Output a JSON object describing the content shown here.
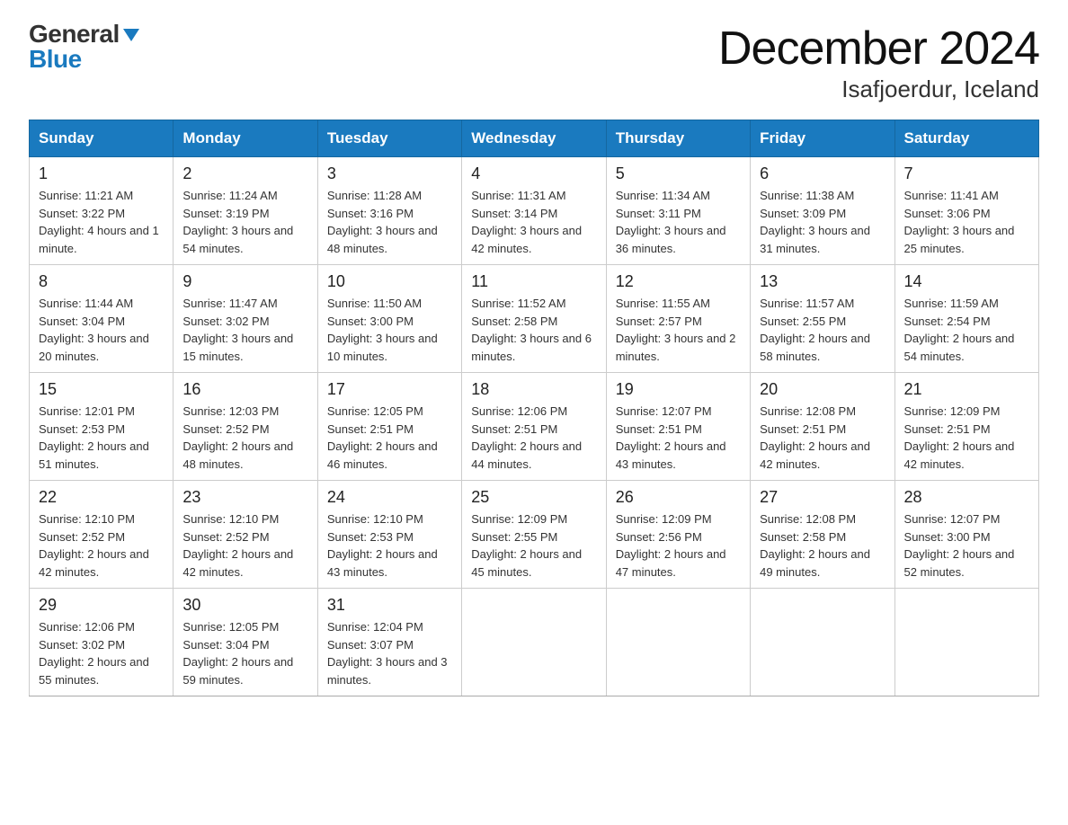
{
  "logo": {
    "general": "General",
    "blue": "Blue"
  },
  "title": "December 2024",
  "subtitle": "Isafjoerdur, Iceland",
  "weekdays": [
    "Sunday",
    "Monday",
    "Tuesday",
    "Wednesday",
    "Thursday",
    "Friday",
    "Saturday"
  ],
  "weeks": [
    [
      {
        "num": "1",
        "sunrise": "11:21 AM",
        "sunset": "3:22 PM",
        "daylight": "4 hours and 1 minute."
      },
      {
        "num": "2",
        "sunrise": "11:24 AM",
        "sunset": "3:19 PM",
        "daylight": "3 hours and 54 minutes."
      },
      {
        "num": "3",
        "sunrise": "11:28 AM",
        "sunset": "3:16 PM",
        "daylight": "3 hours and 48 minutes."
      },
      {
        "num": "4",
        "sunrise": "11:31 AM",
        "sunset": "3:14 PM",
        "daylight": "3 hours and 42 minutes."
      },
      {
        "num": "5",
        "sunrise": "11:34 AM",
        "sunset": "3:11 PM",
        "daylight": "3 hours and 36 minutes."
      },
      {
        "num": "6",
        "sunrise": "11:38 AM",
        "sunset": "3:09 PM",
        "daylight": "3 hours and 31 minutes."
      },
      {
        "num": "7",
        "sunrise": "11:41 AM",
        "sunset": "3:06 PM",
        "daylight": "3 hours and 25 minutes."
      }
    ],
    [
      {
        "num": "8",
        "sunrise": "11:44 AM",
        "sunset": "3:04 PM",
        "daylight": "3 hours and 20 minutes."
      },
      {
        "num": "9",
        "sunrise": "11:47 AM",
        "sunset": "3:02 PM",
        "daylight": "3 hours and 15 minutes."
      },
      {
        "num": "10",
        "sunrise": "11:50 AM",
        "sunset": "3:00 PM",
        "daylight": "3 hours and 10 minutes."
      },
      {
        "num": "11",
        "sunrise": "11:52 AM",
        "sunset": "2:58 PM",
        "daylight": "3 hours and 6 minutes."
      },
      {
        "num": "12",
        "sunrise": "11:55 AM",
        "sunset": "2:57 PM",
        "daylight": "3 hours and 2 minutes."
      },
      {
        "num": "13",
        "sunrise": "11:57 AM",
        "sunset": "2:55 PM",
        "daylight": "2 hours and 58 minutes."
      },
      {
        "num": "14",
        "sunrise": "11:59 AM",
        "sunset": "2:54 PM",
        "daylight": "2 hours and 54 minutes."
      }
    ],
    [
      {
        "num": "15",
        "sunrise": "12:01 PM",
        "sunset": "2:53 PM",
        "daylight": "2 hours and 51 minutes."
      },
      {
        "num": "16",
        "sunrise": "12:03 PM",
        "sunset": "2:52 PM",
        "daylight": "2 hours and 48 minutes."
      },
      {
        "num": "17",
        "sunrise": "12:05 PM",
        "sunset": "2:51 PM",
        "daylight": "2 hours and 46 minutes."
      },
      {
        "num": "18",
        "sunrise": "12:06 PM",
        "sunset": "2:51 PM",
        "daylight": "2 hours and 44 minutes."
      },
      {
        "num": "19",
        "sunrise": "12:07 PM",
        "sunset": "2:51 PM",
        "daylight": "2 hours and 43 minutes."
      },
      {
        "num": "20",
        "sunrise": "12:08 PM",
        "sunset": "2:51 PM",
        "daylight": "2 hours and 42 minutes."
      },
      {
        "num": "21",
        "sunrise": "12:09 PM",
        "sunset": "2:51 PM",
        "daylight": "2 hours and 42 minutes."
      }
    ],
    [
      {
        "num": "22",
        "sunrise": "12:10 PM",
        "sunset": "2:52 PM",
        "daylight": "2 hours and 42 minutes."
      },
      {
        "num": "23",
        "sunrise": "12:10 PM",
        "sunset": "2:52 PM",
        "daylight": "2 hours and 42 minutes."
      },
      {
        "num": "24",
        "sunrise": "12:10 PM",
        "sunset": "2:53 PM",
        "daylight": "2 hours and 43 minutes."
      },
      {
        "num": "25",
        "sunrise": "12:09 PM",
        "sunset": "2:55 PM",
        "daylight": "2 hours and 45 minutes."
      },
      {
        "num": "26",
        "sunrise": "12:09 PM",
        "sunset": "2:56 PM",
        "daylight": "2 hours and 47 minutes."
      },
      {
        "num": "27",
        "sunrise": "12:08 PM",
        "sunset": "2:58 PM",
        "daylight": "2 hours and 49 minutes."
      },
      {
        "num": "28",
        "sunrise": "12:07 PM",
        "sunset": "3:00 PM",
        "daylight": "2 hours and 52 minutes."
      }
    ],
    [
      {
        "num": "29",
        "sunrise": "12:06 PM",
        "sunset": "3:02 PM",
        "daylight": "2 hours and 55 minutes."
      },
      {
        "num": "30",
        "sunrise": "12:05 PM",
        "sunset": "3:04 PM",
        "daylight": "2 hours and 59 minutes."
      },
      {
        "num": "31",
        "sunrise": "12:04 PM",
        "sunset": "3:07 PM",
        "daylight": "3 hours and 3 minutes."
      },
      null,
      null,
      null,
      null
    ]
  ],
  "labels": {
    "sunrise": "Sunrise:",
    "sunset": "Sunset:",
    "daylight": "Daylight:"
  }
}
